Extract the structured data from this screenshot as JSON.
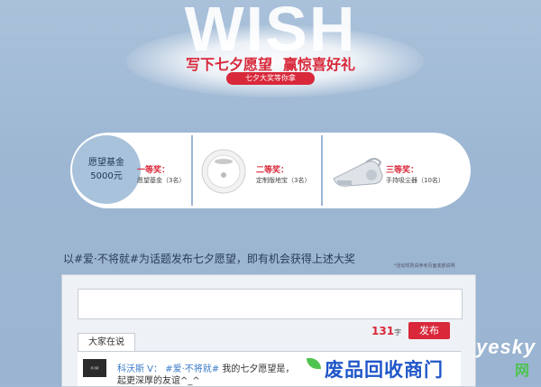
{
  "hero": {
    "title": "WISH",
    "headline_a": "写下七夕愿望",
    "headline_b": "赢惊喜好礼",
    "pill": "七夕大奖等你拿"
  },
  "prizes": [
    {
      "rank": "一等奖：",
      "desc": "愿望基金（3名）",
      "fund_line1": "愿望基金",
      "fund_line2": "5000元"
    },
    {
      "rank": "二等奖：",
      "desc": "定制版地宝（3名）"
    },
    {
      "rank": "三等奖：",
      "desc": "手持吸尘器（10名）"
    }
  ],
  "topic": "以#爱·不将就#为话题发布七夕愿望，即有机会获得上述大奖",
  "rules_note": "*活动规则请参考页面底部说明",
  "composer": {
    "count": "131",
    "unit": "字",
    "publish": "发布"
  },
  "feed": {
    "tab": "大家在说",
    "avatar_text": "科沃斯",
    "post": {
      "user": "科沃斯 V：",
      "tag": "#爱·不将就#",
      "text": "我的七夕愿望是，",
      "text2": "起更深厚的友谊^_^"
    }
  },
  "watermark": {
    "yesky": "yesky",
    "overlay": "废品回收商门",
    "overlay_tail": "网"
  },
  "colors": {
    "accent": "#d8283a",
    "background": "#9cb6d3",
    "link": "#3a7bc8"
  }
}
